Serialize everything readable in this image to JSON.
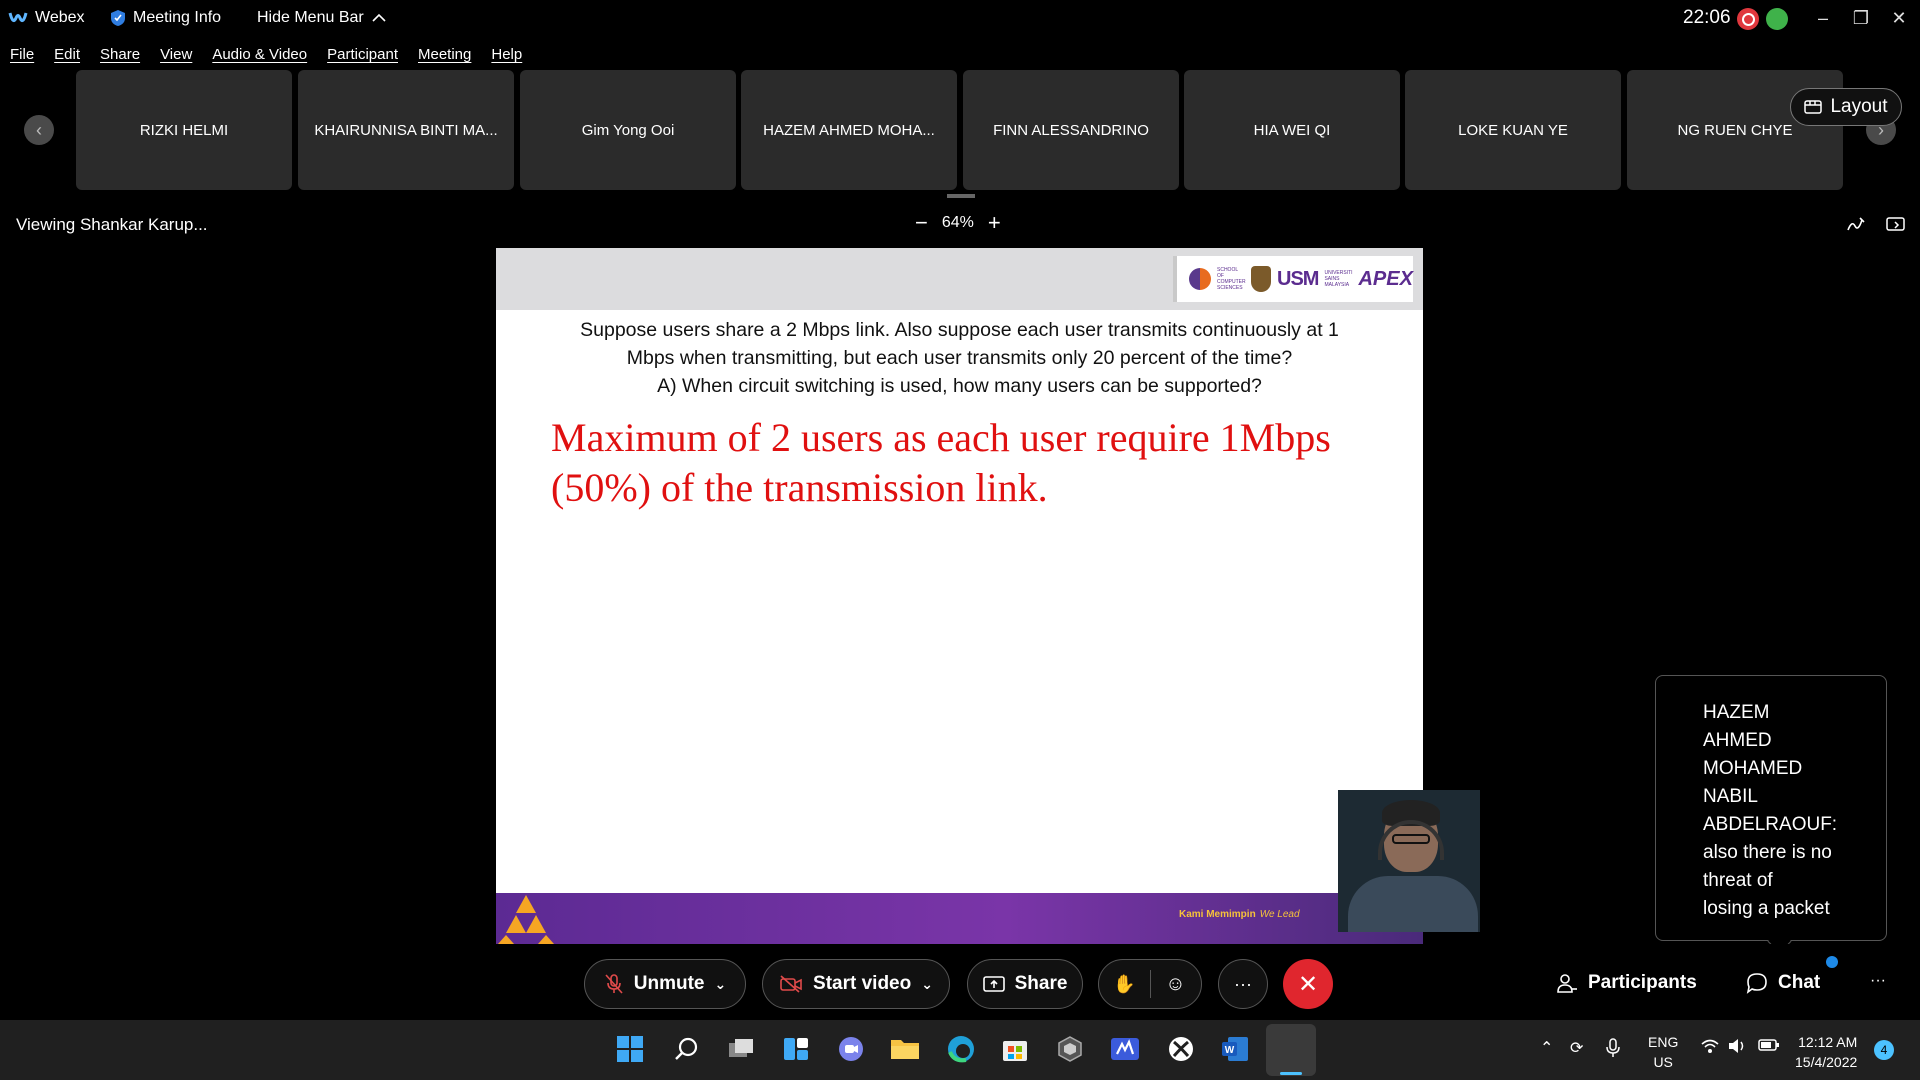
{
  "titlebar": {
    "app_name": "Webex",
    "meeting_info": "Meeting Info",
    "hide_menu_bar": "Hide Menu Bar",
    "time": "22:06"
  },
  "menu": [
    "File",
    "Edit",
    "Share",
    "View",
    "Audio & Video",
    "Participant",
    "Meeting",
    "Help"
  ],
  "participants": [
    "RIZKI HELMI",
    "KHAIRUNNISA BINTI MA...",
    "Gim Yong Ooi",
    "HAZEM AHMED MOHA...",
    "FINN ALESSANDRINO",
    "HIA WEI QI",
    "LOKE KUAN YE",
    "NG RUEN CHYE"
  ],
  "layout_button": "Layout",
  "viewbar": {
    "viewing": "Viewing Shankar Karup...",
    "zoom": "64%",
    "zoom_out": "−",
    "zoom_in": "+"
  },
  "slide": {
    "question_lines": [
      "Suppose users share a 2 Mbps link. Also suppose each user transmits continuously at 1",
      "Mbps when transmitting, but each user transmits only 20 percent of the time?",
      "A) When circuit switching is used, how many users can be supported?"
    ],
    "answer_lines": [
      "Maximum of 2 users as each user require 1Mbps",
      "(50%) of the transmission link."
    ],
    "logo_usm": "USM",
    "logo_apex": "APEX",
    "footer_motto": "Kami Memimpin",
    "footer_motto_en": "We Lead"
  },
  "chat_popup": {
    "lines": [
      "HAZEM",
      "AHMED",
      "MOHAMED",
      "NABIL",
      "ABDELRAOUF:",
      "also there is no",
      "threat of",
      "losing a packet"
    ]
  },
  "controls": {
    "unmute": "Unmute",
    "start_video": "Start video",
    "share": "Share",
    "more": "···",
    "participants": "Participants",
    "chat": "Chat",
    "overflow": "···"
  },
  "taskbar": {
    "lang_line1": "ENG",
    "lang_line2": "US",
    "clock_time": "12:12 AM",
    "clock_date": "15/4/2022",
    "notification_count": "4"
  },
  "colors": {
    "answer_red": "#e01010",
    "end_red": "#e0262e",
    "footer_purple": "#5c2a93",
    "accent_blue": "#1e8ae8"
  }
}
